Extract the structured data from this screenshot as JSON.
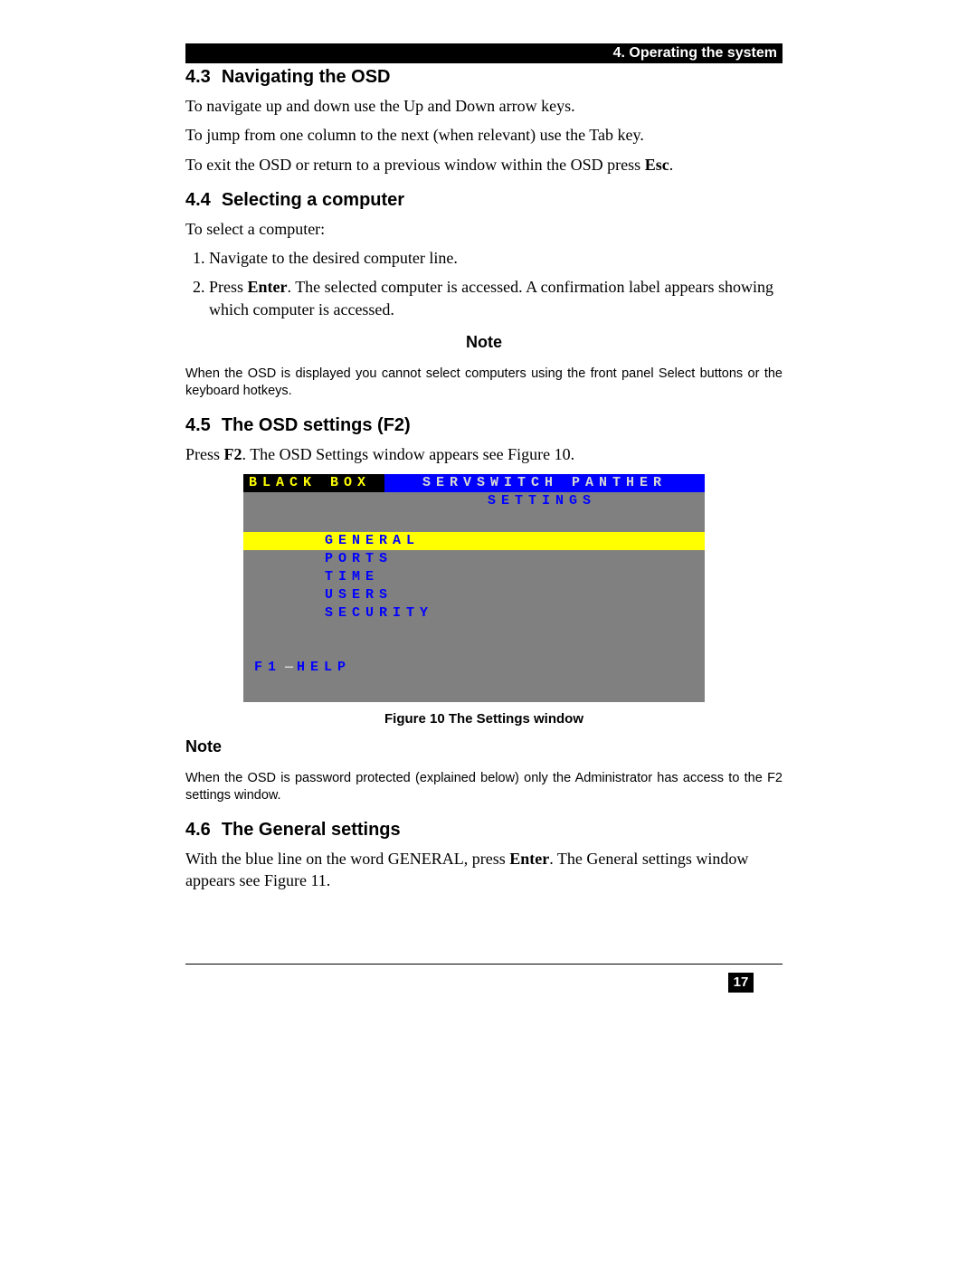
{
  "header": {
    "chapter": "4. Operating the system"
  },
  "sections": {
    "s43": {
      "num": "4.3",
      "title": "Navigating the OSD",
      "p1": "To navigate up and down use the Up and Down arrow keys.",
      "p2": "To jump from one column to the next (when relevant) use the Tab key.",
      "p3_a": "To exit the OSD or return to a previous window within the OSD press ",
      "p3_kw": "Esc",
      "p3_b": "."
    },
    "s44": {
      "num": "4.4",
      "title": "Selecting a computer",
      "intro": "To select a computer:",
      "step1": "Navigate to the desired computer line.",
      "step2_a": "Press ",
      "step2_kw": "Enter",
      "step2_b": ". The selected computer is accessed. A confirmation label appears showing which computer is accessed.",
      "note_heading": "Note",
      "note_body": "When the OSD is displayed you cannot select computers using the front panel Select buttons or the keyboard hotkeys."
    },
    "s45": {
      "num": "4.5",
      "title": "The OSD settings (F2)",
      "p_a": "Press ",
      "p_kw": "F2",
      "p_b": ". The OSD Settings window appears see Figure 10."
    },
    "figure10": {
      "brand": "BLACK  BOX",
      "title": "SERVSWITCH PANTHER",
      "subtitle": "SETTINGS",
      "menu": [
        "GENERAL",
        "PORTS",
        "TIME",
        "USERS",
        "SECURITY"
      ],
      "selected_index": 0,
      "footer_key": "F1",
      "footer_label": "HELP",
      "caption": "Figure 10 The Settings window"
    },
    "note2": {
      "heading": "Note",
      "body": "When the OSD is password protected (explained below) only the Administrator has access to the F2 settings window."
    },
    "s46": {
      "num": "4.6",
      "title": "The General settings",
      "p_a": "With the blue line on the word GENERAL, press ",
      "p_kw": "Enter",
      "p_b": ". The General settings window appears see Figure 11."
    }
  },
  "page_number": "17"
}
